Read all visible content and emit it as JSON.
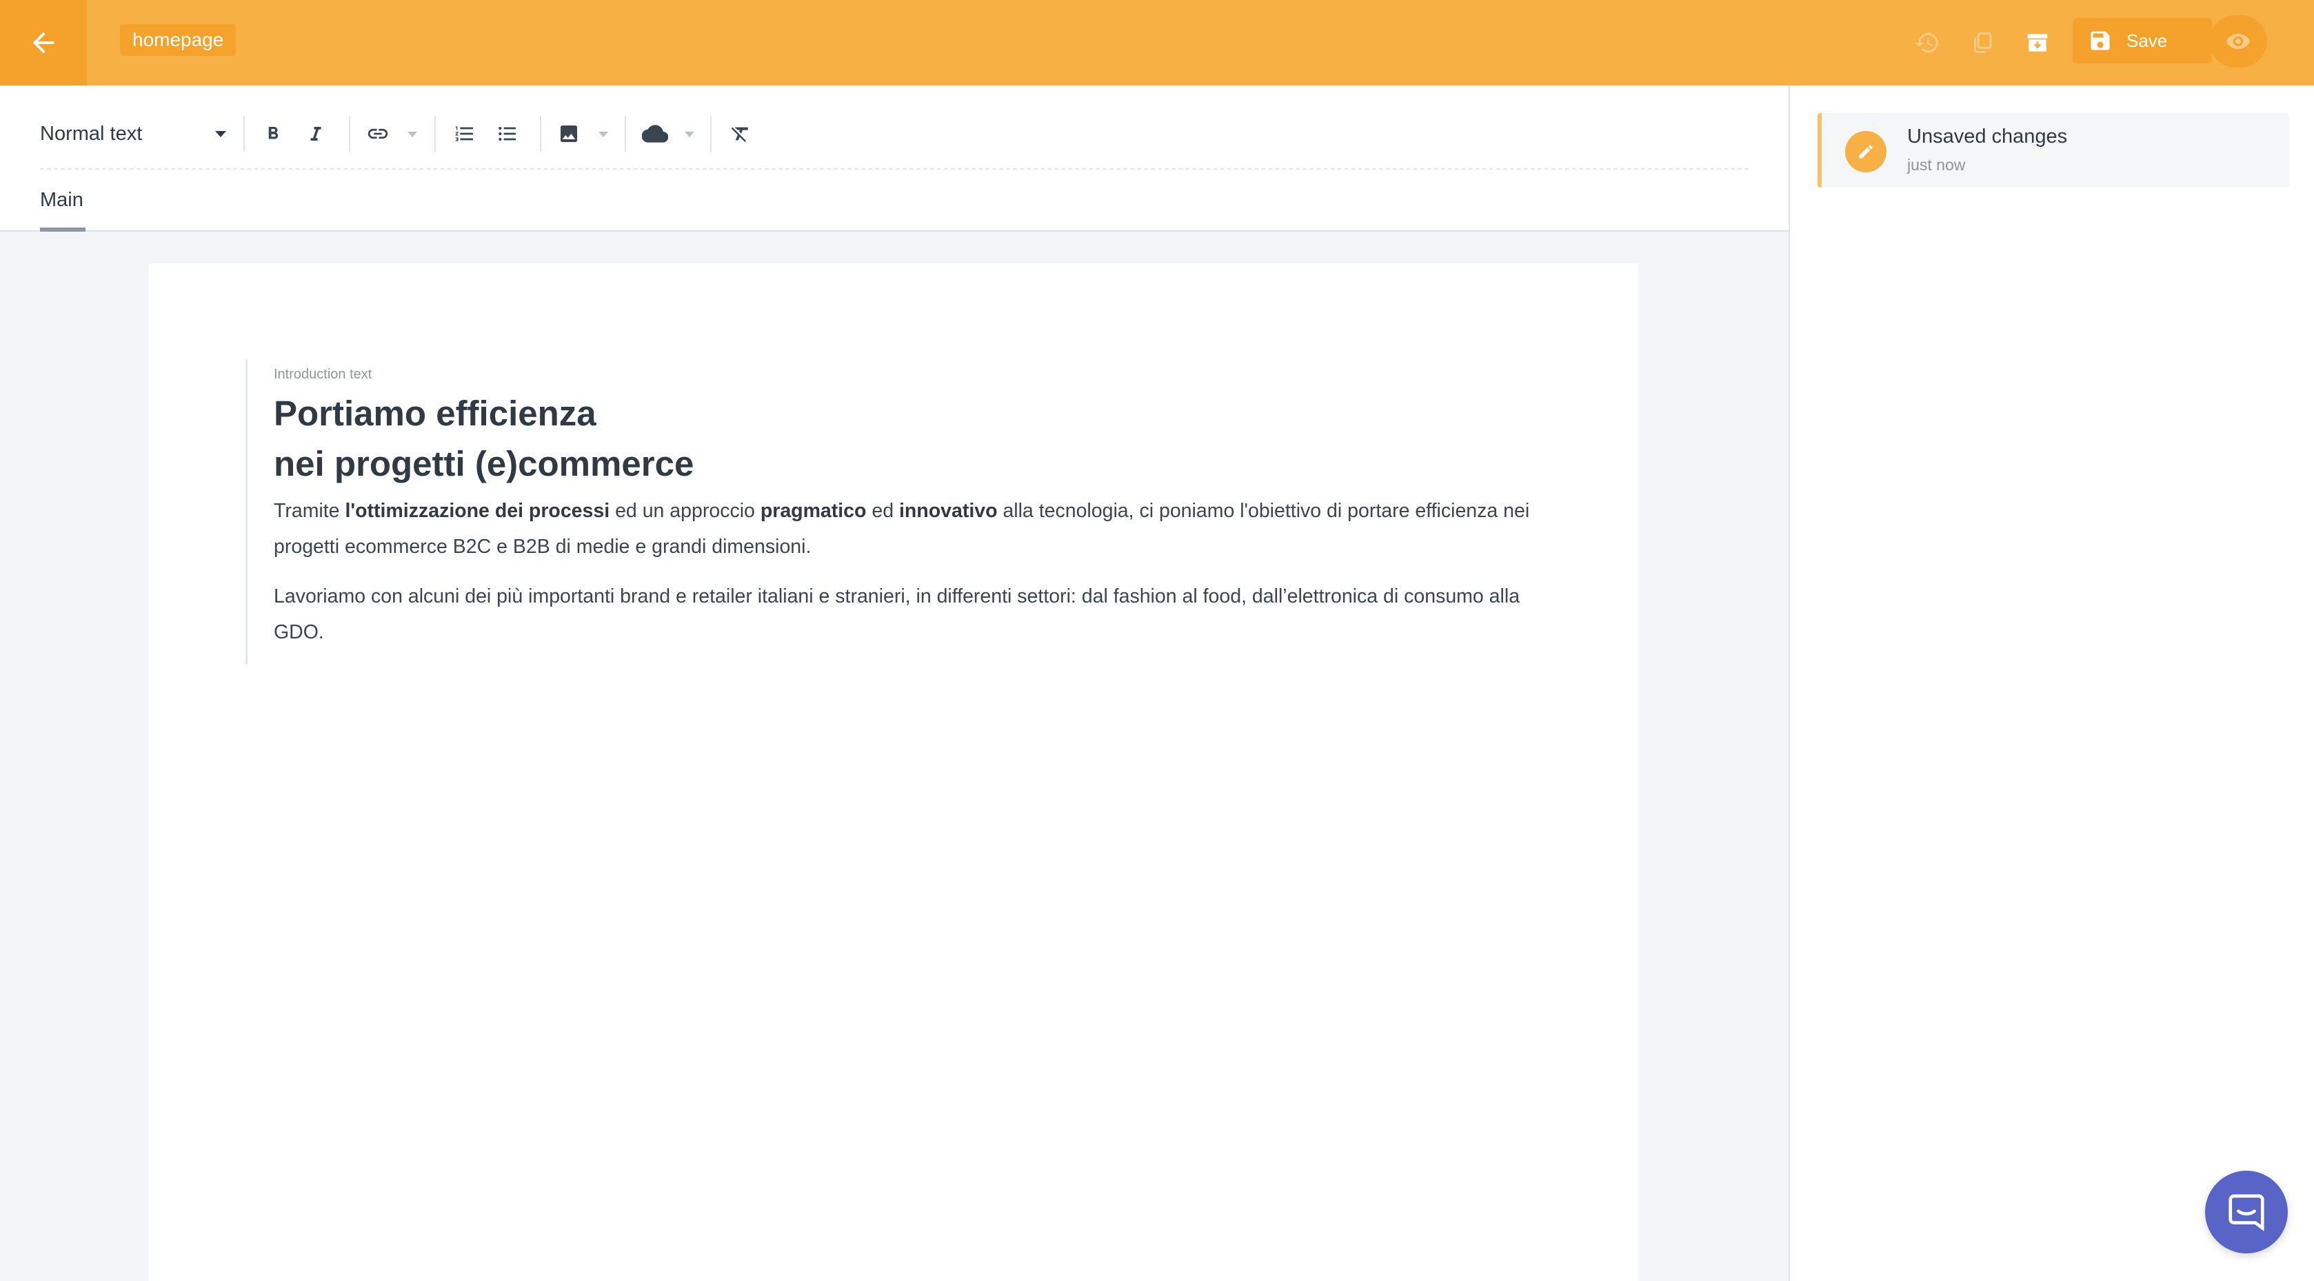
{
  "header": {
    "document_name": "homepage",
    "save_label": "Save"
  },
  "toolbar": {
    "text_style": "Normal text"
  },
  "tabs": [
    {
      "label": "Main",
      "active": true
    }
  ],
  "content": {
    "intro_label": "Introduction text",
    "title": "Portiamo efficienza\nnei progetti (e)commerce",
    "p1": [
      {
        "t": "Tramite ",
        "bold": false
      },
      {
        "t": "l'ottimizzazione dei processi",
        "bold": true
      },
      {
        "t": " ed un approccio ",
        "bold": false
      },
      {
        "t": "pragmatico",
        "bold": true
      },
      {
        "t": " ed ",
        "bold": false
      },
      {
        "t": "innovativo",
        "bold": true
      },
      {
        "t": " alla tecnologia, ci poniamo l'obiettivo di portare efficienza nei progetti ecommerce B2C e B2B di medie e grandi dimensioni.",
        "bold": false
      }
    ],
    "p2": "Lavoriamo con alcuni dei più importanti brand e retailer italiani e stranieri, in differenti settori: dal fashion al food, dall’elettronica di consumo alla GDO."
  },
  "status": {
    "title": "Unsaved changes",
    "time": "just now"
  },
  "icons": {
    "back": "arrow-left-icon",
    "history": "history-icon",
    "duplicate": "copy-icon",
    "archive": "archive-icon",
    "save": "floppy-disk-icon",
    "preview": "eye-icon",
    "chat": "chat-icon"
  },
  "colors": {
    "topbar": "#f7b044",
    "accent_dark": "#f5a22c",
    "chat": "#5865c7"
  }
}
